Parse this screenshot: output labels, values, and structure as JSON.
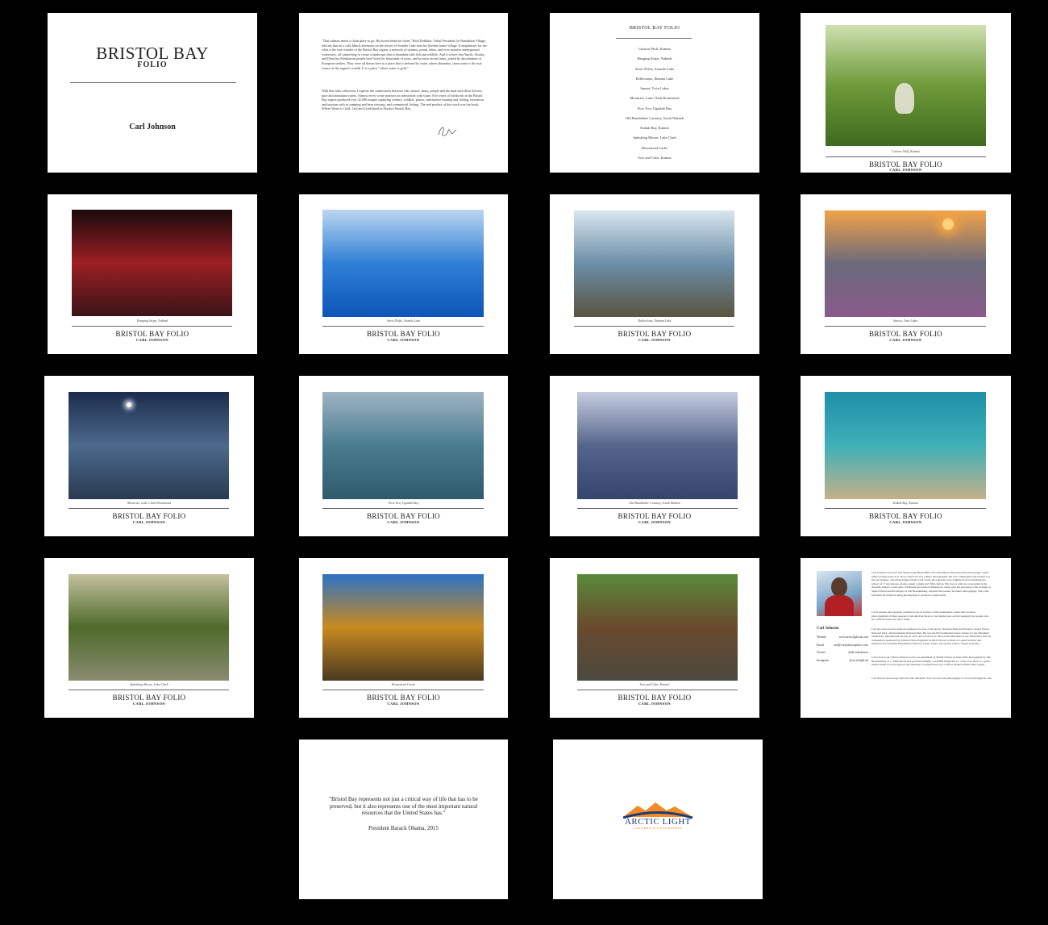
{
  "cover": {
    "title": "BRISTOL BAY",
    "subtitle": "FOLIO",
    "author": "Carl Johnson"
  },
  "intro": {
    "para1": "\"That salmon needs a clean place to go. His home better be clean,\" Rick Delkittie, Tribal President for Nondalton Village, told me that on a cold March afternoon on the shores of Sixmile Lake near his lifetime home village. It emphasizes for me what is the true wonder of the Bristol Bay region: a network of streams, ponds, lakes, and ever-massive underground waterways, all connecting to create a landscape that is abundant with fish and wildlife. And it is here that Yup'ik, Alutiiq, and Dena'ina Athabascan people have lived for thousands of years, and in more recent times, joined by descendants of European settlers. They were all drawn here to a place that is defined by water, where abundant, clean water is the true source of the region's wealth. It is a place \"where water is gold.\"",
    "para2": "With this folio collection, I explore the connections between fish, moose, bears, people and the land with these diverse, pure and abundant waters. Almost every scene portrays an interaction with water. Five years of fieldwork in the Bristol Bay region produced over 32,000 images capturing scenery, wildlife, places, subsistence hunting and fishing, recreation and tourism such as camping and bear viewing, and commercial fishing. The end product of this work was the book, Where Water is Gold: Life and Livelihood in Alaska's Bristol Bay."
  },
  "toc": {
    "title": "BRISTOL BAY FOLIO",
    "items": [
      "Curious Wolf, Katmai",
      "Hanging Strips, Naknek",
      "Snow Drifts, Sixmile Lake",
      "Reflections, Iliamna Lake",
      "Sunset, Twin Lakes",
      "Moonrise, Lake Clark Homestead",
      "First Tow, Ugashik Bay",
      "Old Bumblebee Cannery, South Naknek",
      "Kukak Bay, Katmai",
      "Splashing Moose, Lake Clark",
      "Homestead Cache",
      "Sow and Cubs, Katmai"
    ]
  },
  "footer": {
    "title": "BRISTOL BAY FOLIO",
    "author": "CARL JOHNSON"
  },
  "plates": [
    {
      "caption": "Curious Wolf, Katmai",
      "colors": [
        "#cfe0b0",
        "#6e9a3a",
        "#3f6a1e"
      ]
    },
    {
      "caption": "Hanging Strips, Naknek",
      "colors": [
        "#1a0a0c",
        "#9c1f24",
        "#3a1418"
      ]
    },
    {
      "caption": "Snow Drifts, Sixmile Lake",
      "colors": [
        "#bcd6f0",
        "#2f7fd6",
        "#0d55b8"
      ]
    },
    {
      "caption": "Reflections, Iliamna Lake",
      "colors": [
        "#d9e6ee",
        "#6b8ea8",
        "#5a5540"
      ]
    },
    {
      "caption": "Sunset, Twin Lakes",
      "colors": [
        "#f2a24a",
        "#6a6a7a",
        "#8a5a8c"
      ]
    },
    {
      "caption": "Moonrise, Lake Clark Homestead",
      "colors": [
        "#1c2c4c",
        "#4c6a8c",
        "#2a3a52"
      ]
    },
    {
      "caption": "First Tow, Ugashik Bay",
      "colors": [
        "#9fb4c4",
        "#4a7c90",
        "#2f5a6c"
      ]
    },
    {
      "caption": "Old Bumblebee Cannery, South Naknek",
      "colors": [
        "#c6cde0",
        "#56658c",
        "#34446a"
      ]
    },
    {
      "caption": "Kukak Bay, Katmai",
      "colors": [
        "#1f8fa8",
        "#3fb0b8",
        "#c4b088"
      ]
    },
    {
      "caption": "Splashing Moose, Lake Clark",
      "colors": [
        "#c4c1a0",
        "#4e6a2a",
        "#8a8b70"
      ]
    },
    {
      "caption": "Homestead Cache",
      "colors": [
        "#2d72c4",
        "#c98a20",
        "#4a3a20"
      ]
    },
    {
      "caption": "Sow and Cubs, Katmai",
      "colors": [
        "#5a8a3a",
        "#6a4a2e",
        "#4a4a40"
      ]
    }
  ],
  "bio": {
    "text1": "Carl Johnson was born and raised in the Black Hills of South Dakota. He started his photography career while serving in the U.S. Navy, where he was a ship's photographer. He was commanded and trained in a fine-art manner, and photographed daily work. Early photographs were exhibited before finishing the school of 17 Anchorage, Alaska, using a single 4x5 film camera. His love is with an ocean guide in the Aleutian Waters. Learn Alex Wilderness in northern Minnesota, along with his exposure to the writings of Sigurd Olson and the images of Jim Brandenburg, inspired his journey in nature photography. They also informed his belief in using photography to promote conservation.",
    "text2": "Carl's present photographic pursuits focus on trying to fully understand a particular location, photographing all their seasons, from small pictures to vast landscapes, and increasingly the people who live with the land and call it home.",
    "text3": "Carl has served as the artist-in-residence for four of the Arctic National Park and Preserve, Kenai Fjords National Park, and Kachemak National Park. He was the Environmental Issues winner for the Windland Smith Rice International Awards in 2015 and received two Honorable Mentions in the Wilderness Forever competition sponsored by Nature's Best magazine in 2016. He has worked as a guest lecturer and instructor for Lindblad Expeditions, Princess Cruise Lines, and several remote lodges in Alaska.",
    "text4": "Carl's first book, Where Water is Gold, was published by Braided River in June 2018. Recognized by Jim Brandenburg as a \"tremendous and profound delight,\" and NPR Magazine as \"a true love letter to a place.\" Where Water is Gold explores the amazing ecosystem and way of life in Alaska's Bristol Bay region.",
    "text5": "Carl lives in Anchorage with his wife, Michelle. You can view his photography at www.arcticlight.ak.com.",
    "name": "Carl Johnson",
    "contact": [
      {
        "label": "Website",
        "value": "www.arcticlight.ak.com"
      },
      {
        "label": "Email",
        "value": "carl@carljohnsonphoto.com"
      },
      {
        "label": "Twitter",
        "value": "@akcarljohnson"
      },
      {
        "label": "Instagram",
        "value": "@arcticlight.ak"
      }
    ]
  },
  "quote": {
    "text": "\"Bristol Bay represents not just a critical way of life that has to be preserved, but it also represents one of the most important natural resources that the United States has.\"",
    "attribution": "President Barack Obama, 2015"
  },
  "logo": {
    "name": "ARCTIC LIGHT",
    "tagline": "GALLERY & EXCURSIONS",
    "colors": [
      "#f28c28",
      "#1c3a7a"
    ]
  }
}
